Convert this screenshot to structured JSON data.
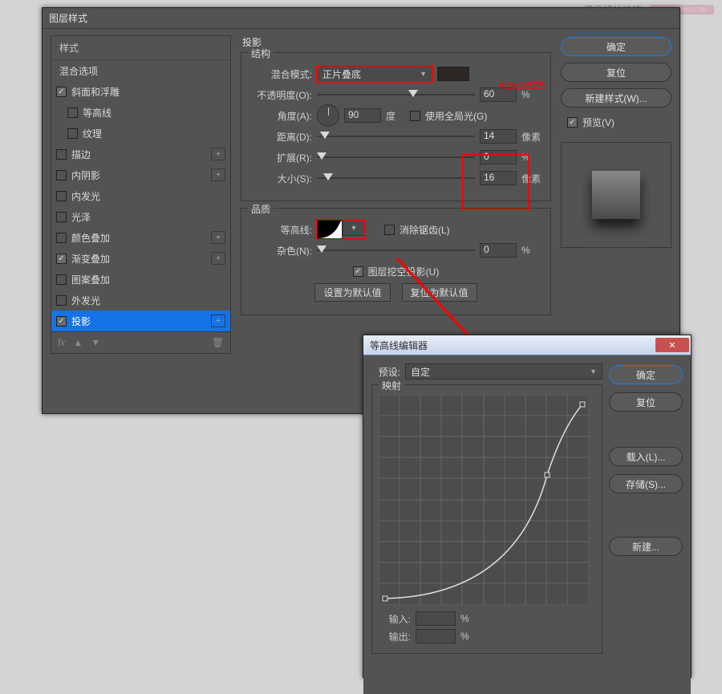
{
  "watermark": {
    "forum": "思缘设计论坛",
    "logo": "MISSYUAN.COM"
  },
  "annotation": {
    "hex": "#2e2825"
  },
  "layerStyle": {
    "title": "图层样式",
    "section": "投影",
    "stylesHeader": "样式",
    "blendOptions": "混合选项",
    "items": [
      {
        "label": "斜面和浮雕",
        "checked": true,
        "selected": false,
        "plus": false,
        "indent": 0
      },
      {
        "label": "等高线",
        "checked": false,
        "selected": false,
        "plus": false,
        "indent": 1
      },
      {
        "label": "纹理",
        "checked": false,
        "selected": false,
        "plus": false,
        "indent": 1
      },
      {
        "label": "描边",
        "checked": false,
        "selected": false,
        "plus": true,
        "indent": 0
      },
      {
        "label": "内阴影",
        "checked": false,
        "selected": false,
        "plus": true,
        "indent": 0
      },
      {
        "label": "内发光",
        "checked": false,
        "selected": false,
        "plus": false,
        "indent": 0
      },
      {
        "label": "光泽",
        "checked": false,
        "selected": false,
        "plus": false,
        "indent": 0
      },
      {
        "label": "颜色叠加",
        "checked": false,
        "selected": false,
        "plus": true,
        "indent": 0
      },
      {
        "label": "渐变叠加",
        "checked": true,
        "selected": false,
        "plus": true,
        "indent": 0
      },
      {
        "label": "图案叠加",
        "checked": false,
        "selected": false,
        "plus": false,
        "indent": 0
      },
      {
        "label": "外发光",
        "checked": false,
        "selected": false,
        "plus": false,
        "indent": 0
      },
      {
        "label": "投影",
        "checked": true,
        "selected": true,
        "plus": true,
        "indent": 0
      }
    ],
    "fxLabel": "fx",
    "structure": {
      "title": "结构",
      "blendModeLabel": "混合模式:",
      "blendModeValue": "正片叠底",
      "opacityLabel": "不透明度(O):",
      "opacityValue": "60",
      "opacityUnit": "%",
      "angleLabel": "角度(A):",
      "angleValue": "90",
      "angleUnit": "度",
      "globalLightLabel": "使用全局光(G)",
      "globalLightChecked": false,
      "distanceLabel": "距离(D):",
      "distanceValue": "14",
      "distanceUnit": "像素",
      "spreadLabel": "扩展(R):",
      "spreadValue": "0",
      "spreadUnit": "%",
      "sizeLabel": "大小(S):",
      "sizeValue": "16",
      "sizeUnit": "像素"
    },
    "quality": {
      "title": "品质",
      "contourLabel": "等高线:",
      "antiAliasLabel": "消除锯齿(L)",
      "antiAliasChecked": false,
      "noiseLabel": "杂色(N):",
      "noiseValue": "0",
      "noiseUnit": "%"
    },
    "knockoutLabel": "图层挖空投影(U)",
    "knockoutChecked": true,
    "setDefault": "设置为默认值",
    "resetDefault": "复位为默认值",
    "buttons": {
      "ok": "确定",
      "cancel": "复位",
      "newStyle": "新建样式(W)...",
      "preview": "预览(V)"
    }
  },
  "contourEditor": {
    "title": "等高线编辑器",
    "presetLabel": "预设:",
    "presetValue": "自定",
    "mapping": "映射",
    "inputLabel": "输入:",
    "inputUnit": "%",
    "outputLabel": "输出:",
    "outputUnit": "%",
    "buttons": {
      "ok": "确定",
      "cancel": "复位",
      "load": "载入(L)...",
      "save": "存储(S)...",
      "new": "新建..."
    }
  }
}
